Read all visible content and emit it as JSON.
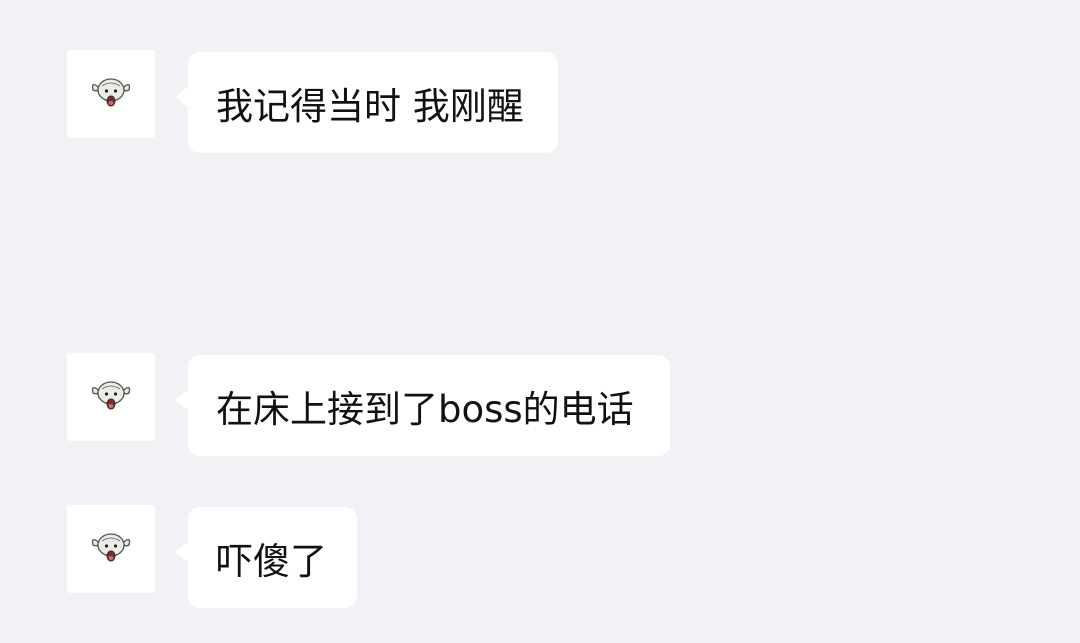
{
  "chat": {
    "messages": [
      {
        "sender_avatar": "sheep-avatar-icon",
        "text": "我记得当时 我刚醒"
      },
      {
        "sender_avatar": "sheep-avatar-icon",
        "text": "在床上接到了boss的电话"
      },
      {
        "sender_avatar": "sheep-avatar-icon",
        "text": "吓傻了"
      }
    ]
  },
  "colors": {
    "background": "#f2f1f6",
    "bubble": "#ffffff",
    "text": "#111111"
  }
}
